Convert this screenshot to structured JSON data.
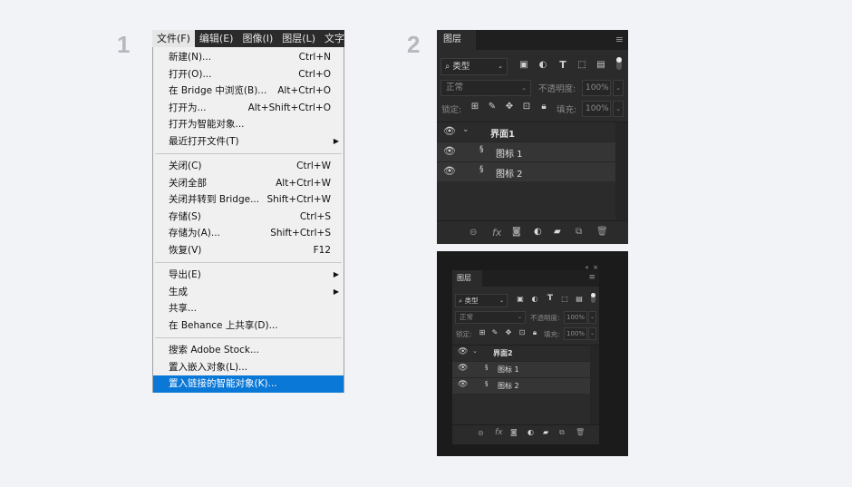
{
  "steps": {
    "one": "1",
    "two": "2"
  },
  "menubar": [
    "文件(F)",
    "编辑(E)",
    "图像(I)",
    "图层(L)",
    "文字"
  ],
  "menu_items": [
    {
      "label": "新建(N)...",
      "shortcut": "Ctrl+N"
    },
    {
      "label": "打开(O)...",
      "shortcut": "Ctrl+O"
    },
    {
      "label": "在 Bridge 中浏览(B)...",
      "shortcut": "Alt+Ctrl+O"
    },
    {
      "label": "打开为...",
      "shortcut": "Alt+Shift+Ctrl+O"
    },
    {
      "label": "打开为智能对象...",
      "shortcut": ""
    },
    {
      "label": "最近打开文件(T)",
      "shortcut": "",
      "submenu": true
    },
    {
      "sep": true
    },
    {
      "label": "关闭(C)",
      "shortcut": "Ctrl+W"
    },
    {
      "label": "关闭全部",
      "shortcut": "Alt+Ctrl+W"
    },
    {
      "label": "关闭并转到 Bridge...",
      "shortcut": "Shift+Ctrl+W"
    },
    {
      "label": "存储(S)",
      "shortcut": "Ctrl+S"
    },
    {
      "label": "存储为(A)...",
      "shortcut": "Shift+Ctrl+S"
    },
    {
      "label": "恢复(V)",
      "shortcut": "F12"
    },
    {
      "sep": true
    },
    {
      "label": "导出(E)",
      "shortcut": "",
      "submenu": true
    },
    {
      "label": "生成",
      "shortcut": "",
      "submenu": true
    },
    {
      "label": "共享...",
      "shortcut": ""
    },
    {
      "label": "在 Behance 上共享(D)...",
      "shortcut": ""
    },
    {
      "sep": true
    },
    {
      "label": "搜索 Adobe Stock...",
      "shortcut": ""
    },
    {
      "label": "置入嵌入对象(L)...",
      "shortcut": ""
    },
    {
      "label": "置入链接的智能对象(K)...",
      "shortcut": "",
      "highlighted": true
    }
  ],
  "panel1": {
    "tab": "图层",
    "filter_label": "类型",
    "blend_mode": "正常",
    "opacity_label": "不透明度:",
    "opacity_value": "100%",
    "lock_label": "锁定:",
    "fill_label": "填充:",
    "fill_value": "100%",
    "group_name": "界面1",
    "layers": [
      "图标 1",
      "图标 2"
    ]
  },
  "panel2": {
    "tab": "图层",
    "filter_label": "类型",
    "blend_mode": "正常",
    "opacity_label": "不透明度:",
    "opacity_value": "100%",
    "lock_label": "锁定:",
    "fill_label": "填充:",
    "fill_value": "100%",
    "group_name": "界面2",
    "layers": [
      "图标 1",
      "图标 2"
    ]
  },
  "icons": {
    "filter_icons": [
      "image-filter-icon",
      "adjustment-filter-icon",
      "type-filter-icon",
      "shape-filter-icon",
      "smart-object-filter-icon",
      "filter-toggle-icon"
    ],
    "lock_icons": [
      "lock-transparent-icon",
      "lock-paint-icon",
      "lock-position-icon",
      "lock-artboard-icon",
      "lock-all-icon"
    ],
    "footer_icons": [
      "link-layers-icon",
      "fx-icon",
      "add-mask-icon",
      "new-adjustment-icon",
      "new-group-icon",
      "new-layer-icon",
      "delete-layer-icon"
    ]
  },
  "colors": {
    "highlight": "#0a78d7",
    "panel_bg": "#2b2b2b",
    "page_bg": "#f2f3f7"
  }
}
